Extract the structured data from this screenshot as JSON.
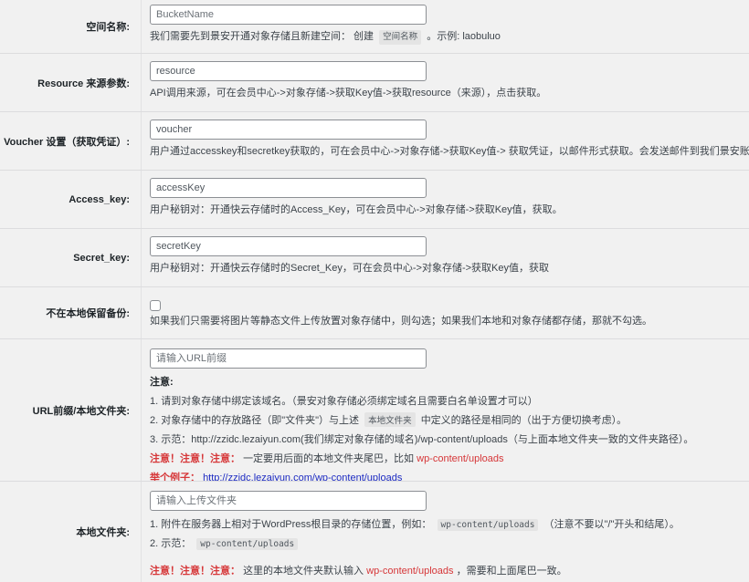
{
  "bucket": {
    "label": "空间名称:",
    "placeholder": "BucketName",
    "desc_before": "我们需要先到景安开通对象存储且新建空间： 创建",
    "desc_code": "空间名称",
    "desc_after": "。示例: laobuluo"
  },
  "resource": {
    "label": "Resource 来源参数:",
    "value": "resource",
    "desc": "API调用来源，可在会员中心->对象存储->获取Key值->获取resource（来源），点击获取。"
  },
  "voucher": {
    "label": "Voucher 设置（获取凭证）:",
    "value": "voucher",
    "desc": "用户通过accesskey和secretkey获取的，可在会员中心->对象存储->获取Key值-> 获取凭证，以邮件形式获取。会发送邮件到我们景安账户邮箱"
  },
  "access_key": {
    "label": "Access_key:",
    "value": "accessKey",
    "desc": "用户秘钥对：开通快云存储时的Access_Key，可在会员中心->对象存储->获取Key值，获取。"
  },
  "secret_key": {
    "label": "Secret_key:",
    "value": "secretKey",
    "desc": "用户秘钥对：开通快云存储时的Secret_Key，可在会员中心->对象存储->获取Key值，获取"
  },
  "no_local": {
    "label": "不在本地保留备份:",
    "desc": "如果我们只需要将图片等静态文件上传放置对象存储中，则勾选；如果我们本地和对象存储都存储，那就不勾选。"
  },
  "url_prefix": {
    "label": "URL前缀/本地文件夹:",
    "placeholder": "请输入URL前缀",
    "note_head": "注意:",
    "line1": "1. 请到对象存储中绑定该域名。（景安对象存储必须绑定域名且需要白名单设置才可以）",
    "line2_before": "2. 对象存储中的存放路径（即\"文件夹\"）与上述",
    "line2_code": "本地文件夹",
    "line2_after": "中定义的路径是相同的（出于方便切换考虑）。",
    "line3": "3. 示范：http://zzidc.lezaiyun.com(我们绑定对象存储的域名)/wp-content/uploads（与上面本地文件夹一致的文件夹路径）。",
    "warn_label": "注意！注意！注意：",
    "warn_text": "一定要用后面的本地文件夹尾巴，比如",
    "warn_path": "wp-content/uploads",
    "example_label": "举个例子：",
    "example_url": "http://zzidc.lezaiyun.com/wp-content/uploads"
  },
  "local_folder": {
    "label": "本地文件夹:",
    "placeholder": "请输入上传文件夹",
    "line1_before": "1. 附件在服务器上相对于WordPress根目录的存储位置，例如：",
    "line1_code": "wp-content/uploads",
    "line1_after": "（注意不要以\"/\"开头和结尾）。",
    "line2_before": "2. 示范：",
    "line2_code": "wp-content/uploads",
    "warn_label": "注意！注意！注意：",
    "warn_text": "这里的本地文件夹默认输入",
    "warn_path": "wp-content/uploads",
    "warn_after": "，需要和上面尾巴一致。"
  }
}
